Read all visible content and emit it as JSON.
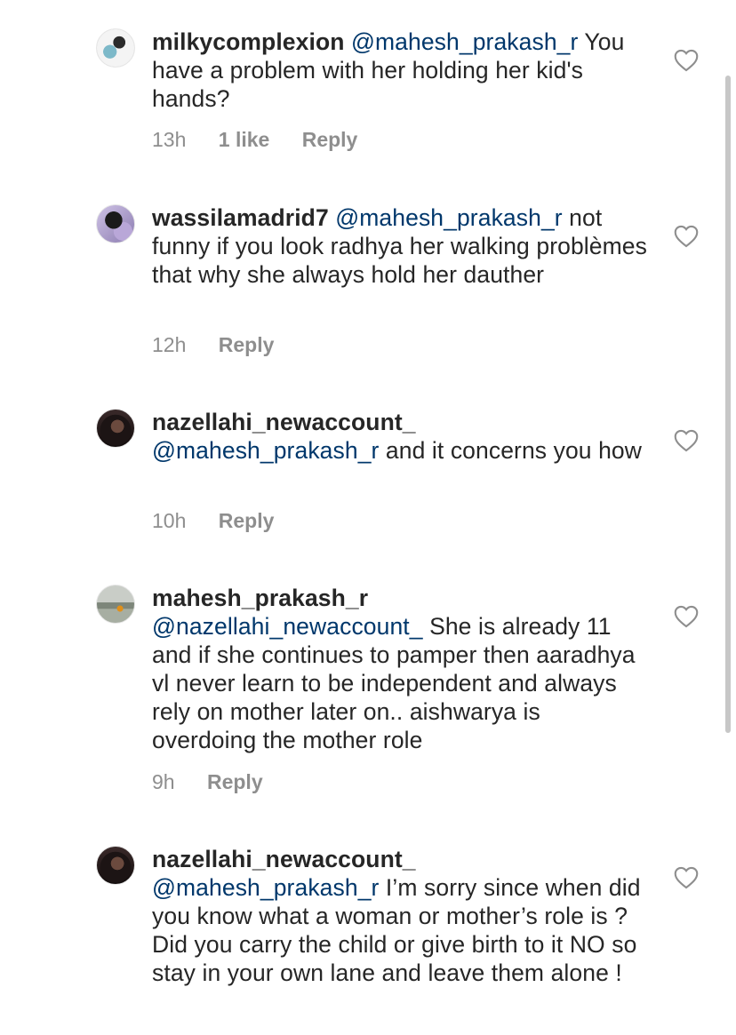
{
  "comments": [
    {
      "username": "milkycomplexion",
      "mention": "@mahesh_prakash_r",
      "body": " You have a problem with her holding her kid's hands?",
      "time": "13h",
      "likes": "1 like",
      "reply": "Reply",
      "like_icon": "heart-outline-icon"
    },
    {
      "username": "wassilamadrid7",
      "mention": "@mahesh_prakash_r",
      "body": " not funny if you look radhya her walking problèmes that why she always hold her dauther",
      "time": "12h",
      "reply": "Reply",
      "like_icon": "heart-outline-icon"
    },
    {
      "username": "nazellahi_newaccount_",
      "mention": "@mahesh_prakash_r",
      "body": " and it concerns you how",
      "time": "10h",
      "reply": "Reply",
      "like_icon": "heart-outline-icon"
    },
    {
      "username": "mahesh_prakash_r",
      "mention": "@nazellahi_newaccount_",
      "body": " She is already 11 and if she continues to pamper then aaradhya vl never learn to be independent and always rely on mother later on.. aishwarya is overdoing the mother role",
      "time": "9h",
      "reply": "Reply",
      "like_icon": "heart-outline-icon"
    },
    {
      "username": "nazellahi_newaccount_",
      "mention": "@mahesh_prakash_r",
      "body": " I’m sorry since when did you know what a woman or mother’s role is ? Did you carry the child or give birth to it NO so stay in your own lane and leave them alone !",
      "time": "",
      "reply": "",
      "like_icon": "heart-outline-icon"
    }
  ],
  "colors": {
    "text": "#262626",
    "mention": "#00376b",
    "meta": "#8e8e8e"
  }
}
